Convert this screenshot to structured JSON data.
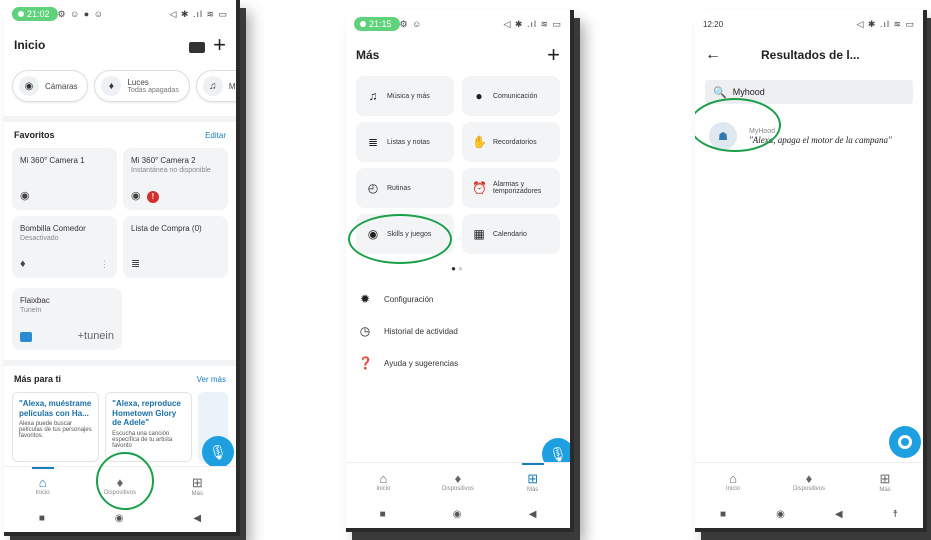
{
  "accent": "#1a7fb8",
  "highlight_color": "#1c9f4a",
  "phone1": {
    "status_time": "21:02",
    "status_icons": "⚙ ☺ ● ☺",
    "status_right": "◁ ✱ .ıl ≋ ▭",
    "title": "Inicio",
    "chips": [
      {
        "icon": "camera-icon",
        "glyph": "◉",
        "label": "Cámaras",
        "sub": ""
      },
      {
        "icon": "bulb-icon",
        "glyph": "♦",
        "label": "Luces",
        "sub": "Todas apagadas"
      },
      {
        "icon": "music-icon",
        "glyph": "♫",
        "label": "Mú",
        "sub": ""
      }
    ],
    "favorites_title": "Favoritos",
    "favorites_edit": "Editar",
    "cards": [
      {
        "title": "Mi 360° Camera 1",
        "sub": ""
      },
      {
        "title": "Mi 360° Camera 2",
        "sub": "Instantánea no disponible"
      },
      {
        "title": "Bombilla Comedor",
        "sub": "Desactivado"
      },
      {
        "title": "Lista de Compra (0)",
        "sub": ""
      }
    ],
    "tunein_card": {
      "title": "Flaixbac",
      "sub": "TuneIn",
      "logo": "+tunein"
    },
    "mas_title": "Más para ti",
    "mas_link": "Ver más",
    "promos": [
      {
        "quote": "\"Alexa, muéstrame películas con Ha...",
        "desc": "Alexa puede buscar películas de tus personajes favoritos."
      },
      {
        "quote": "\"Alexa, reproduce Hometown Glory de Adele\"",
        "desc": "Escucha una canción específica de tu artista favorito"
      }
    ],
    "nav": [
      "Inicio",
      "Dispositivos",
      "Más"
    ]
  },
  "phone2": {
    "status_time": "21:15",
    "status_icons": "⚙ ☺",
    "status_right": "◁ ✱ .ıl ≋ ▭",
    "title": "Más",
    "tiles": [
      {
        "icon": "music-note-icon",
        "glyph": "♫",
        "label": "Música y más"
      },
      {
        "icon": "chat-icon",
        "glyph": "●",
        "label": "Comunicación"
      },
      {
        "icon": "list-icon",
        "glyph": "≣",
        "label": "Listas y notas"
      },
      {
        "icon": "reminder-icon",
        "glyph": "✋",
        "label": "Recordatorios"
      },
      {
        "icon": "routine-icon",
        "glyph": "◴",
        "label": "Rutinas"
      },
      {
        "icon": "alarm-icon",
        "glyph": "⏰",
        "label": "Alarmas y temporizadores"
      },
      {
        "icon": "skills-icon",
        "glyph": "◉",
        "label": "Skills y juegos"
      },
      {
        "icon": "calendar-icon",
        "glyph": "▦",
        "label": "Calendario"
      }
    ],
    "list": [
      {
        "icon": "settings-icon",
        "glyph": "✹",
        "label": "Configuración"
      },
      {
        "icon": "history-icon",
        "glyph": "◷",
        "label": "Historial de actividad"
      },
      {
        "icon": "help-icon",
        "glyph": "❓",
        "label": "Ayuda y sugerencias"
      }
    ],
    "nav": [
      "Inicio",
      "Dispositivos",
      "Más"
    ]
  },
  "phone3": {
    "status_time": "12:20",
    "status_right": "◁ ✱ .ıl ≋ ▭",
    "title": "Resultados de l...",
    "search_value": "Myhood",
    "result_name": "MyHood",
    "result_phrase": "\"Alexa, apaga el motor de la campana\"",
    "nav": [
      "Inicio",
      "Dispositivos",
      "Más"
    ]
  }
}
